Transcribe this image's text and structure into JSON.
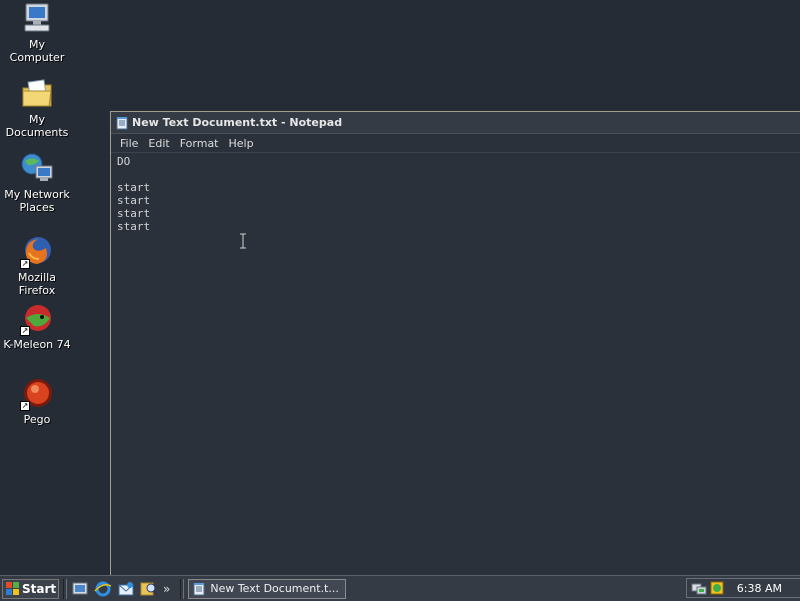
{
  "desktop": {
    "icons": [
      {
        "label": "My Computer"
      },
      {
        "label": "My Documents"
      },
      {
        "label": "My Network Places"
      },
      {
        "label": "Mozilla Firefox"
      },
      {
        "label": "K-Meleon 74"
      },
      {
        "label": "Pego"
      }
    ]
  },
  "notepad": {
    "title": "New Text Document.txt - Notepad",
    "menu": [
      "File",
      "Edit",
      "Format",
      "Help"
    ],
    "content": "DO\n\nstart\nstart\nstart\nstart"
  },
  "taskbar": {
    "start_label": "Start",
    "quicklaunch_icons": [
      "show-desktop-icon",
      "internet-explorer-icon",
      "outlook-express-icon",
      "search-icon"
    ],
    "chevron": "»",
    "task_label": "New Text Document.t...",
    "tray_icons": [
      "network-icon",
      "security-icon"
    ],
    "clock": "6:38 AM"
  },
  "colors": {
    "desktop_bg": "#262c36",
    "window_bg": "#2b313b",
    "taskbar_bg": "#353b45",
    "text": "#d4d4d4"
  }
}
